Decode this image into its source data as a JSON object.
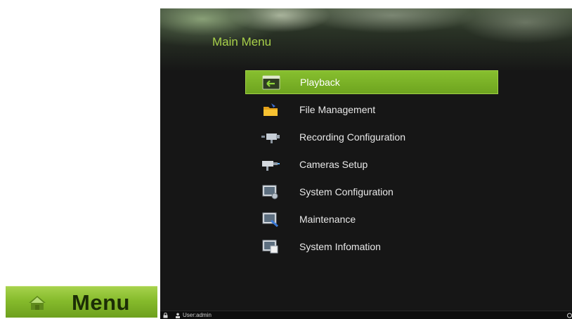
{
  "menu_button": {
    "label": "Menu",
    "icon": "home-icon"
  },
  "dvr": {
    "title": "Main Menu",
    "items": [
      {
        "label": "Playback",
        "icon": "playback-icon",
        "selected": true
      },
      {
        "label": "File Management",
        "icon": "folder-icon",
        "selected": false
      },
      {
        "label": "Recording Configuration",
        "icon": "recording-camera-icon",
        "selected": false
      },
      {
        "label": "Cameras Setup",
        "icon": "camera-icon",
        "selected": false
      },
      {
        "label": "System Configuration",
        "icon": "system-config-icon",
        "selected": false
      },
      {
        "label": "Maintenance",
        "icon": "maintenance-icon",
        "selected": false
      },
      {
        "label": "System Infomation",
        "icon": "system-info-icon",
        "selected": false
      }
    ],
    "status": {
      "user": "User:admin"
    }
  },
  "colors": {
    "accent_green": "#86bb2c",
    "title_green": "#a8d04a",
    "screen_bg": "#161616"
  }
}
